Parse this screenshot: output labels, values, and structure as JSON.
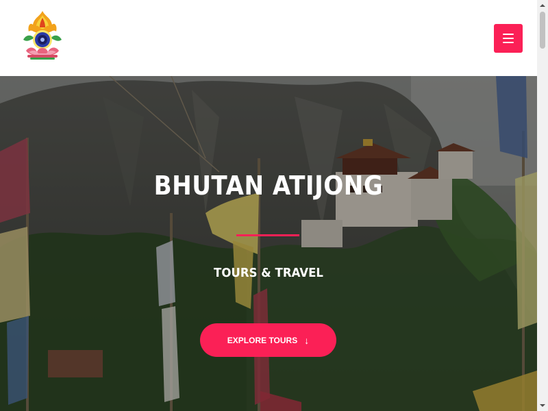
{
  "header": {
    "logo_icon": "lotus-emblem-icon",
    "menu_icon": "hamburger-menu-icon"
  },
  "hero": {
    "title": "BHUTAN ATIJONG",
    "subtitle": "TOURS & TRAVEL",
    "cta_label": "EXPLORE TOURS",
    "cta_icon": "arrow-down-icon",
    "cta_glyph": "↓"
  },
  "colors": {
    "accent": "#fb2056",
    "header_bg": "#ffffff",
    "text_on_hero": "#ffffff"
  }
}
